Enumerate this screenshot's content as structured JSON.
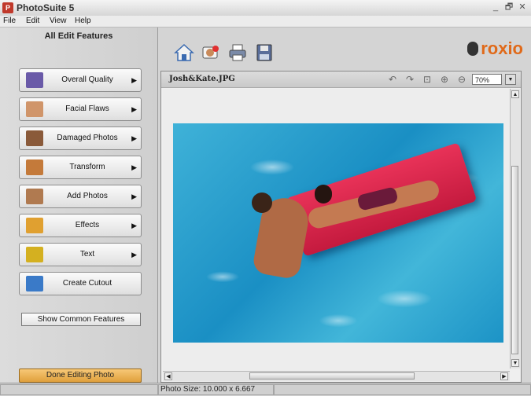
{
  "app": {
    "title": "PhotoSuite 5",
    "window_controls": [
      "_",
      "🗗",
      "✕"
    ]
  },
  "menu": [
    "File",
    "Edit",
    "View",
    "Help"
  ],
  "left_panel": {
    "header": "All Edit Features",
    "features": [
      {
        "label": "Overall Quality",
        "icon": "overall-quality-icon",
        "color": "#6a5aa8"
      },
      {
        "label": "Facial Flaws",
        "icon": "facial-flaws-icon",
        "color": "#d0956a"
      },
      {
        "label": "Damaged Photos",
        "icon": "damaged-photos-icon",
        "color": "#8a5a3a"
      },
      {
        "label": "Transform",
        "icon": "transform-icon",
        "color": "#c47a3a"
      },
      {
        "label": "Add Photos",
        "icon": "add-photos-icon",
        "color": "#b07a50"
      },
      {
        "label": "Effects",
        "icon": "effects-icon",
        "color": "#e0a030"
      },
      {
        "label": "Text",
        "icon": "text-icon",
        "color": "#d4b020"
      },
      {
        "label": "Create Cutout",
        "icon": "create-cutout-icon",
        "color": "#3a7ac8"
      }
    ],
    "arrow": "▶",
    "show_common": "Show Common Features",
    "done": "Done Editing Photo"
  },
  "toolbar": {
    "icons": [
      "home-icon",
      "photos-icon",
      "print-icon",
      "save-icon"
    ],
    "logo": "roxio"
  },
  "document": {
    "filename": "Josh&Kate.JPG",
    "zoom": "70%",
    "tools": [
      "undo-icon",
      "redo-icon",
      "fit-to-window-icon",
      "zoom-in-icon",
      "zoom-out-icon"
    ]
  },
  "status": {
    "photo_size": "Photo Size: 10.000 x 6.667"
  },
  "colors": {
    "accent": "#e06a1a",
    "done_button": "#e8b050",
    "float": "#d62a4e",
    "water": "#2aa0d0"
  }
}
